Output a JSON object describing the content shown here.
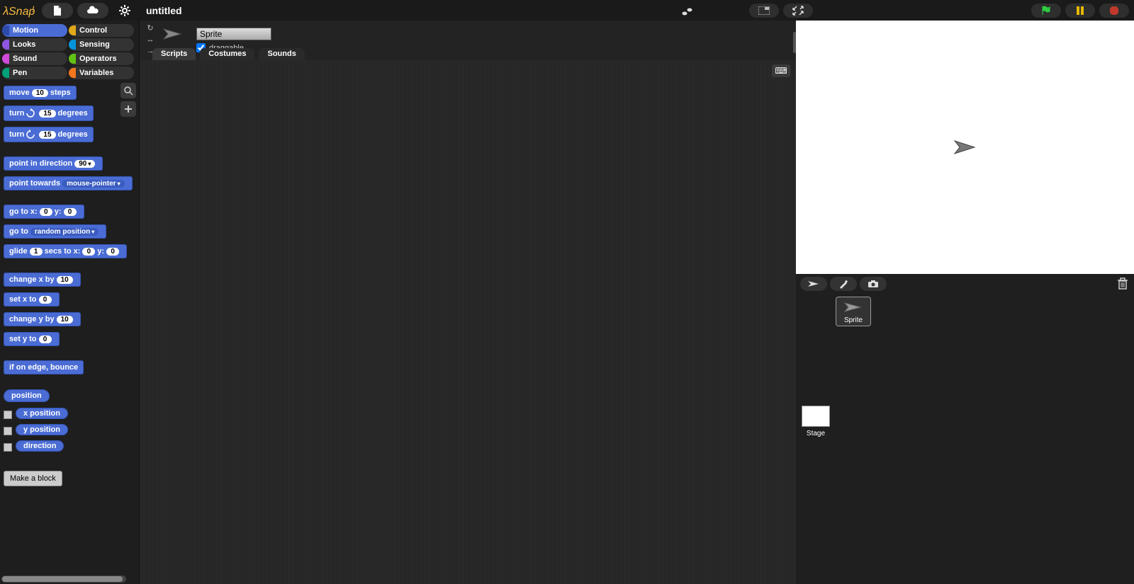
{
  "app": {
    "name": "Snap!",
    "project": "untitled"
  },
  "topbar": {
    "file_icon": "file-icon",
    "cloud_icon": "cloud-icon",
    "gear_icon": "gear-icon",
    "footsteps_icon": "footsteps-icon",
    "small_stage_icon": "small-stage-icon",
    "fullscreen_icon": "fullscreen-icon",
    "flag_icon": "green-flag-icon",
    "pause_icon": "pause-icon",
    "stop_icon": "stop-icon"
  },
  "categories": [
    {
      "name": "Motion",
      "color": "#4a6cd4",
      "selected": true
    },
    {
      "name": "Control",
      "color": "#e1a91a",
      "selected": false
    },
    {
      "name": "Looks",
      "color": "#8f56e3",
      "selected": false
    },
    {
      "name": "Sensing",
      "color": "#0494dc",
      "selected": false
    },
    {
      "name": "Sound",
      "color": "#cf4ad9",
      "selected": false
    },
    {
      "name": "Operators",
      "color": "#62c213",
      "selected": false
    },
    {
      "name": "Pen",
      "color": "#00a178",
      "selected": false
    },
    {
      "name": "Variables",
      "color": "#f3761d",
      "selected": false
    }
  ],
  "palette": {
    "search_icon": "search-icon",
    "add_icon": "plus-icon",
    "make_block": "Make a block",
    "blocks": {
      "move": {
        "a": "move",
        "n1": "10",
        "b": "steps"
      },
      "turnCW": {
        "a": "turn",
        "icon": "cw",
        "n1": "15",
        "b": "degrees"
      },
      "turnCCW": {
        "a": "turn",
        "icon": "ccw",
        "n1": "15",
        "b": "degrees"
      },
      "pointDir": {
        "a": "point in direction",
        "dd": "90"
      },
      "pointTowards": {
        "a": "point towards",
        "dd": "mouse-pointer"
      },
      "gotoXY": {
        "a": "go to x:",
        "n1": "0",
        "b": "y:",
        "n2": "0"
      },
      "goto": {
        "a": "go to",
        "dd": "random position"
      },
      "glide": {
        "a": "glide",
        "n1": "1",
        "b": "secs to x:",
        "n2": "0",
        "c": "y:",
        "n3": "0"
      },
      "changeX": {
        "a": "change x by",
        "n1": "10"
      },
      "setX": {
        "a": "set x to",
        "n1": "0"
      },
      "changeY": {
        "a": "change y by",
        "n1": "10"
      },
      "setY": {
        "a": "set y to",
        "n1": "0"
      },
      "bounce": {
        "a": "if on edge, bounce"
      },
      "posHeader": "position",
      "xpos": "x position",
      "ypos": "y position",
      "dir": "direction"
    }
  },
  "sprite": {
    "name": "Sprite",
    "draggable_label": "draggable",
    "draggable": true,
    "rot_icons": [
      "rotate",
      "flip",
      "fixed"
    ]
  },
  "tabs": [
    {
      "label": "Scripts",
      "active": true
    },
    {
      "label": "Costumes",
      "active": false
    },
    {
      "label": "Sounds",
      "active": false
    }
  ],
  "corral": {
    "new_turtle_icon": "turtle-icon",
    "paint_icon": "paint-icon",
    "camera_icon": "camera-icon",
    "trash_icon": "trash-icon",
    "sprites": [
      {
        "name": "Sprite",
        "selected": true
      }
    ],
    "stage_label": "Stage"
  }
}
